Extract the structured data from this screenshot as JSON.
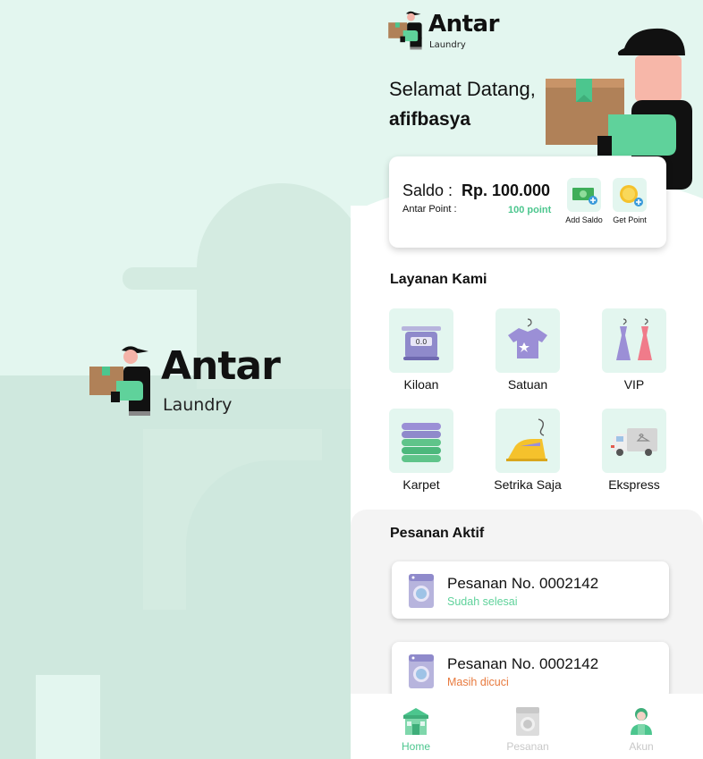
{
  "brand": {
    "name": "Antar",
    "tagline": "Laundry"
  },
  "header": {
    "greeting": "Selamat Datang,",
    "username": "afifbasya"
  },
  "balance": {
    "saldo_label": "Saldo :",
    "saldo_value": "Rp. 100.000",
    "point_label": "Antar Point :",
    "point_value": "100 point",
    "actions": [
      {
        "label": "Add Saldo",
        "icon": "money-add-icon"
      },
      {
        "label": "Get Point",
        "icon": "coin-add-icon"
      }
    ]
  },
  "services": {
    "title": "Layanan Kami",
    "items": [
      {
        "label": "Kiloan",
        "icon": "scale-icon"
      },
      {
        "label": "Satuan",
        "icon": "shirt-icon"
      },
      {
        "label": "VIP",
        "icon": "dresses-icon"
      },
      {
        "label": "Karpet",
        "icon": "carpet-stack-icon"
      },
      {
        "label": "Setrika Saja",
        "icon": "iron-icon"
      },
      {
        "label": "Ekspress",
        "icon": "delivery-truck-icon"
      }
    ]
  },
  "orders": {
    "title": "Pesanan Aktif",
    "items": [
      {
        "number": "Pesanan No. 0002142",
        "status": "Sudah selesai",
        "status_color": "#5fd29b"
      },
      {
        "number": "Pesanan No. 0002142",
        "status": "Masih dicuci",
        "status_color": "#e87a3e"
      }
    ]
  },
  "nav": {
    "items": [
      {
        "label": "Home",
        "icon": "laundry-shop-icon",
        "active": true
      },
      {
        "label": "Pesanan",
        "icon": "washing-machine-icon",
        "active": false
      },
      {
        "label": "Akun",
        "icon": "person-icon",
        "active": false
      }
    ]
  },
  "colors": {
    "accent": "#4cc68e",
    "mint_background": "#e3f6ef",
    "status_done": "#5fd29b",
    "status_washing": "#e87a3e",
    "nav_inactive": "#c8c8c8"
  }
}
